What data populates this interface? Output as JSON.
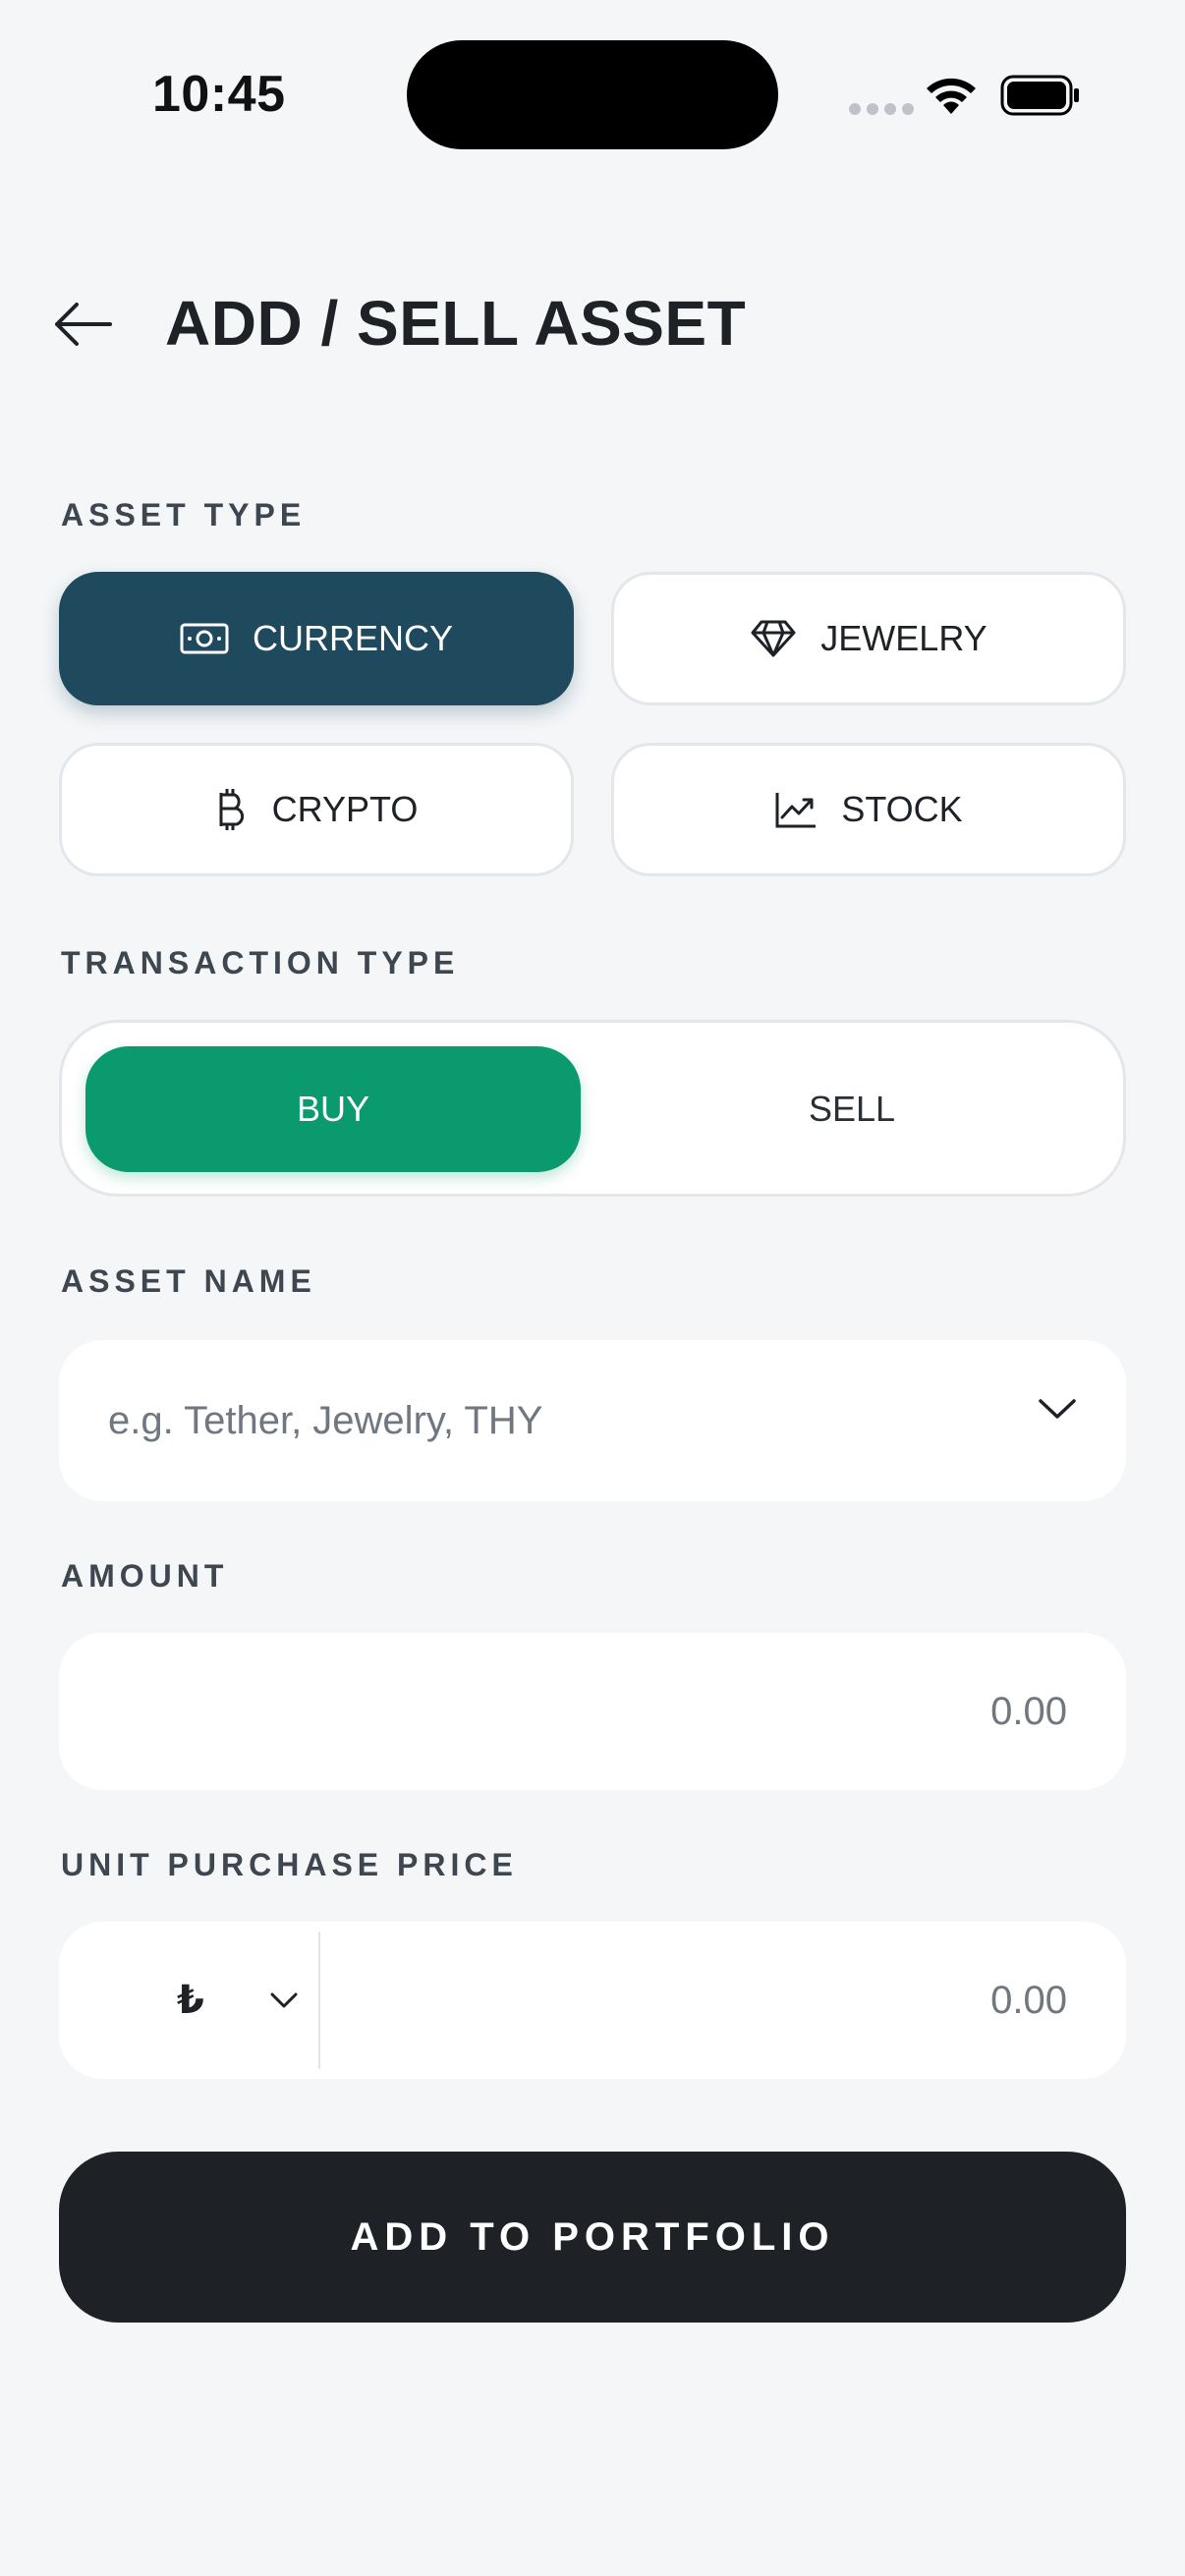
{
  "status_bar": {
    "time": "10:45"
  },
  "header": {
    "title": "ADD / SELL ASSET"
  },
  "asset_type": {
    "label": "ASSET TYPE",
    "options": [
      {
        "label": "CURRENCY",
        "icon": "banknote-icon",
        "selected": true
      },
      {
        "label": "JEWELRY",
        "icon": "diamond-icon",
        "selected": false
      },
      {
        "label": "CRYPTO",
        "icon": "bitcoin-icon",
        "selected": false
      },
      {
        "label": "STOCK",
        "icon": "line-chart-icon",
        "selected": false
      }
    ]
  },
  "transaction_type": {
    "label": "TRANSACTION TYPE",
    "options": [
      {
        "label": "BUY",
        "selected": true
      },
      {
        "label": "SELL",
        "selected": false
      }
    ]
  },
  "asset_name": {
    "label": "ASSET NAME",
    "placeholder": "e.g. Tether, Jewelry, THY",
    "value": ""
  },
  "amount": {
    "label": "AMOUNT",
    "placeholder": "0.00",
    "value": ""
  },
  "unit_price": {
    "label": "UNIT PURCHASE PRICE",
    "currency": "₺",
    "placeholder": "0.00",
    "value": ""
  },
  "submit": {
    "label": "ADD TO PORTFOLIO"
  },
  "colors": {
    "background": "#F4F6F8",
    "primary_dark": "#1E2227",
    "selected_asset": "#1F4A5E",
    "buy_green": "#0A9A6E"
  }
}
